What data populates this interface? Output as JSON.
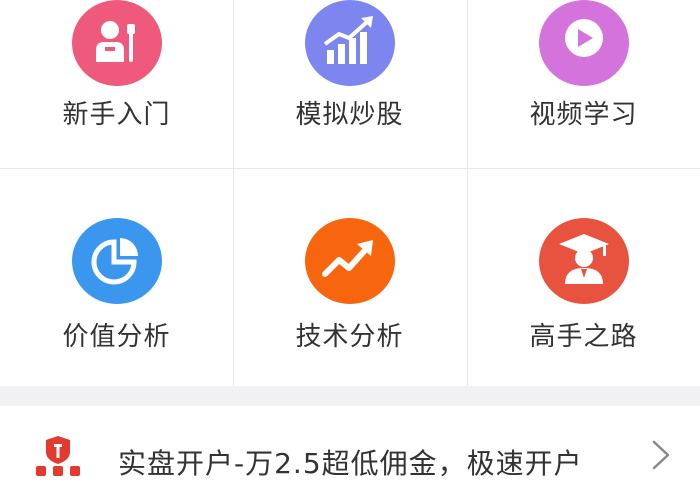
{
  "grid": {
    "items": [
      {
        "label": "新手入门",
        "icon": "beginner-icon",
        "color": "#ef5a7c"
      },
      {
        "label": "模拟炒股",
        "icon": "rising-bar-chart-icon",
        "color": "#7d86ee"
      },
      {
        "label": "视频学习",
        "icon": "play-video-icon",
        "color": "#d573dc"
      },
      {
        "label": "价值分析",
        "icon": "pie-chart-icon",
        "color": "#3b97ee"
      },
      {
        "label": "技术分析",
        "icon": "trend-arrow-icon",
        "color": "#f7660f"
      },
      {
        "label": "高手之路",
        "icon": "graduate-icon",
        "color": "#e8533f"
      }
    ]
  },
  "promo": {
    "text": "实盘开户-万2.5超低佣金，极速开户",
    "icon": "red-seal-icon",
    "icon_color": "#e23a2f"
  },
  "colors": {
    "divider": "#e8e8e8",
    "section_gap": "#f1f1f4",
    "text": "#333333"
  }
}
